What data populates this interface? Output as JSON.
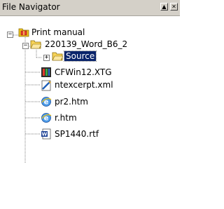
{
  "window": {
    "title": "File Navigator",
    "buttons": {
      "restore": "▲",
      "close": "✕"
    }
  },
  "tree": {
    "root": {
      "label": "Print manual",
      "icon": "folder-open-gift-icon",
      "expanded": true
    },
    "project": {
      "label": "220139_Word_B6_2",
      "icon": "folder-open-icon",
      "expanded": true
    },
    "source": {
      "label": "Source",
      "icon": "folder-open-icon",
      "expanded": false,
      "selected": true
    },
    "files": [
      {
        "label": "CFWin12.XTG",
        "icon": "xtg-file-icon"
      },
      {
        "label": "ntexcerpt.xml",
        "icon": "xml-file-icon"
      },
      {
        "label": "pr2.htm",
        "icon": "ie-htm-file-icon"
      },
      {
        "label": "r.htm",
        "icon": "ie-htm-file-icon"
      },
      {
        "label": "SP1440.rtf",
        "icon": "word-rtf-file-icon"
      }
    ]
  },
  "colors": {
    "selection": "#0a246a",
    "titlebar": "#d4d0c8"
  }
}
